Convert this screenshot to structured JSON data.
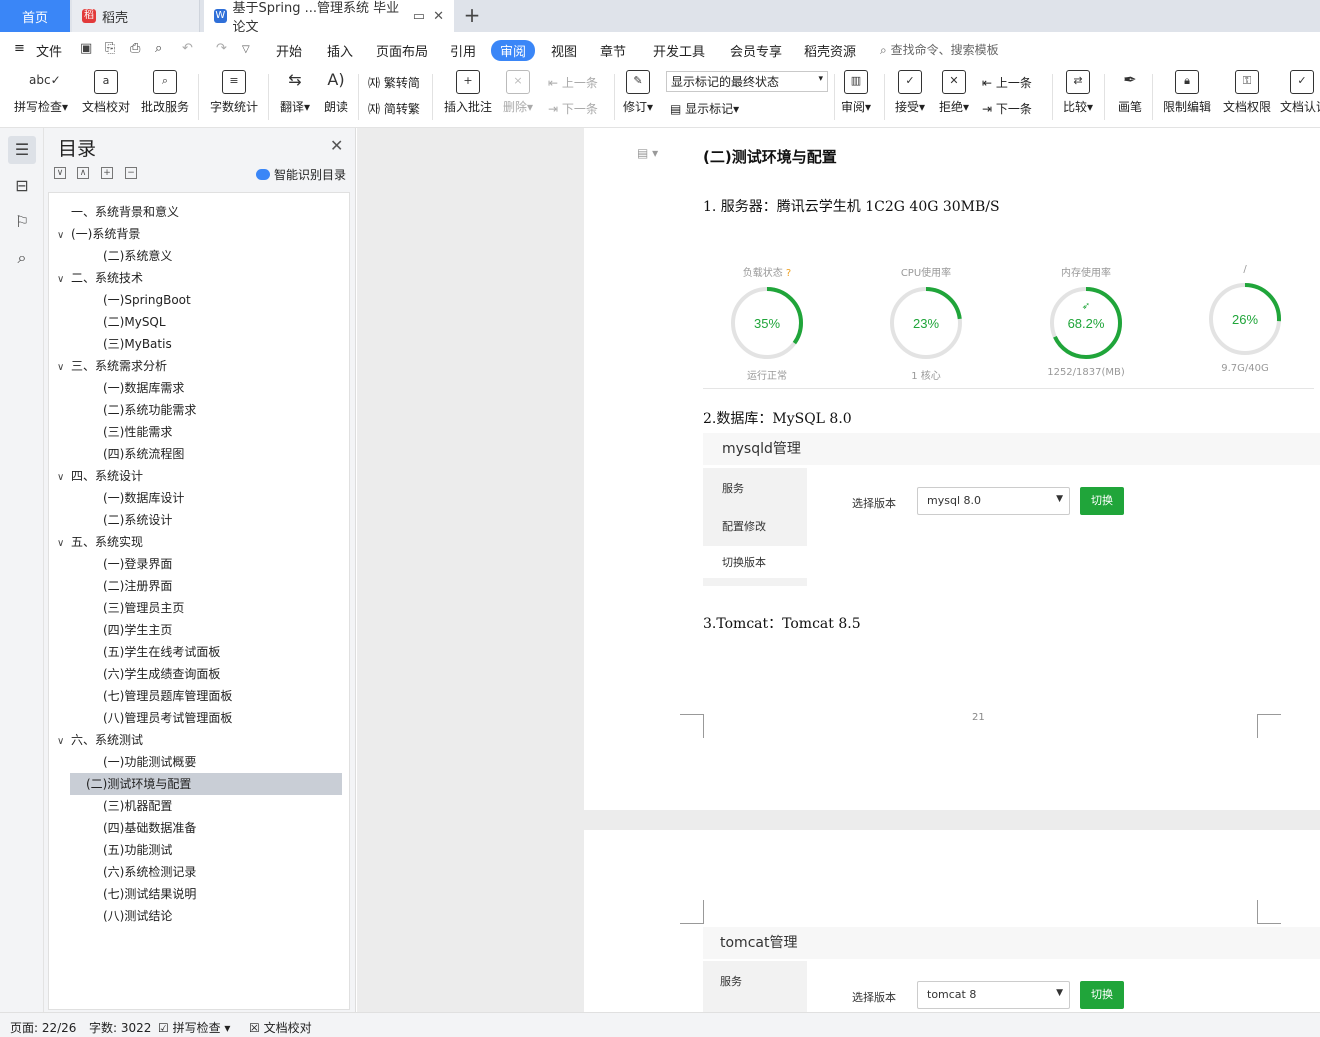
{
  "tabs": {
    "home": "首页",
    "daoke": "稻壳",
    "doc": "基于Spring ...管理系统 毕业论文"
  },
  "menu": [
    "文件",
    "开始",
    "插入",
    "页面布局",
    "引用",
    "审阅",
    "视图",
    "章节",
    "开发工具",
    "会员专享",
    "稻壳资源"
  ],
  "search_placeholder": "查找命令、搜索模板",
  "ribbon": {
    "spell": "拼写检查",
    "proof": "文档校对",
    "batch": "批改服务",
    "wordcount": "字数统计",
    "translate": "翻译",
    "read": "朗读",
    "t2s": "繁转简",
    "s2t": "简转繁",
    "comment": "插入批注",
    "delete": "删除",
    "prev": "上一条",
    "next": "下一条",
    "revise": "修订",
    "markup_state": "显示标记的最终状态",
    "show_markup": "显示标记",
    "review": "审阅",
    "accept": "接受",
    "reject": "拒绝",
    "prev2": "上一条",
    "next2": "下一条",
    "compare": "比较",
    "pen": "画笔",
    "restrict": "限制编辑",
    "perm": "文档权限",
    "cert": "文档认证"
  },
  "toc": {
    "title": "目录",
    "smart": "智能识别目录",
    "items": [
      {
        "text": "一、系统背景和意义",
        "level": 1,
        "arrow": ""
      },
      {
        "text": "(一)系统背景",
        "level": 1,
        "arrow": "∨"
      },
      {
        "text": "(二)系统意义",
        "level": 2,
        "arrow": ""
      },
      {
        "text": "二、系统技术",
        "level": 1,
        "arrow": "∨"
      },
      {
        "text": "(一)SpringBoot",
        "level": 2,
        "arrow": ""
      },
      {
        "text": "(二)MySQL",
        "level": 2,
        "arrow": ""
      },
      {
        "text": "(三)MyBatis",
        "level": 2,
        "arrow": ""
      },
      {
        "text": "三、系统需求分析",
        "level": 1,
        "arrow": "∨"
      },
      {
        "text": "(一)数据库需求",
        "level": 2,
        "arrow": ""
      },
      {
        "text": "(二)系统功能需求",
        "level": 2,
        "arrow": ""
      },
      {
        "text": "(三)性能需求",
        "level": 2,
        "arrow": ""
      },
      {
        "text": "(四)系统流程图",
        "level": 2,
        "arrow": ""
      },
      {
        "text": "四、系统设计",
        "level": 1,
        "arrow": "∨"
      },
      {
        "text": "(一)数据库设计",
        "level": 2,
        "arrow": ""
      },
      {
        "text": "(二)系统设计",
        "level": 2,
        "arrow": ""
      },
      {
        "text": "五、系统实现",
        "level": 1,
        "arrow": "∨"
      },
      {
        "text": "(一)登录界面",
        "level": 2,
        "arrow": ""
      },
      {
        "text": "(二)注册界面",
        "level": 2,
        "arrow": ""
      },
      {
        "text": "(三)管理员主页",
        "level": 2,
        "arrow": ""
      },
      {
        "text": "(四)学生主页",
        "level": 2,
        "arrow": ""
      },
      {
        "text": "(五)学生在线考试面板",
        "level": 2,
        "arrow": ""
      },
      {
        "text": "(六)学生成绩查询面板",
        "level": 2,
        "arrow": ""
      },
      {
        "text": "(七)管理员题库管理面板",
        "level": 2,
        "arrow": ""
      },
      {
        "text": "(八)管理员考试管理面板",
        "level": 2,
        "arrow": ""
      },
      {
        "text": "六、系统测试",
        "level": 1,
        "arrow": "∨"
      },
      {
        "text": "(一)功能测试概要",
        "level": 2,
        "arrow": ""
      },
      {
        "text": "(二)测试环境与配置",
        "level": 2,
        "arrow": "",
        "selected": true
      },
      {
        "text": "(三)机器配置",
        "level": 2,
        "arrow": ""
      },
      {
        "text": "(四)基础数据准备",
        "level": 2,
        "arrow": ""
      },
      {
        "text": "(五)功能测试",
        "level": 2,
        "arrow": ""
      },
      {
        "text": "(六)系统检测记录",
        "level": 2,
        "arrow": ""
      },
      {
        "text": "(七)测试结果说明",
        "level": 2,
        "arrow": ""
      },
      {
        "text": "(八)测试结论",
        "level": 2,
        "arrow": ""
      }
    ]
  },
  "doc": {
    "heading": "(二)测试环境与配置",
    "server": "1. 服务器：腾讯云学生机 1C2G 40G 30MB/S",
    "gauges": [
      {
        "label": "负载状态",
        "value": "35%",
        "sub": "运行正常",
        "pct": 35
      },
      {
        "label": "CPU使用率",
        "value": "23%",
        "sub": "1 核心",
        "pct": 23
      },
      {
        "label": "内存使用率",
        "value": "68.2%",
        "sub": "1252/1837(MB)",
        "pct": 68.2
      },
      {
        "label": "/",
        "value": "26%",
        "sub": "9.7G/40G",
        "pct": 26
      }
    ],
    "db": "2.数据库：MySQL 8.0",
    "mysql_panel": {
      "title": "mysqld管理",
      "side": [
        "服务",
        "配置修改",
        "切换版本"
      ],
      "label": "选择版本",
      "value": "mysql 8.0",
      "button": "切换"
    },
    "tomcat": "3.Tomcat：Tomcat 8.5",
    "page_no": "21",
    "tomcat_panel": {
      "title": "tomcat管理",
      "side": [
        "服务"
      ],
      "label": "选择版本",
      "value": "tomcat 8",
      "button": "切换"
    }
  },
  "status": {
    "page": "页面: 22/26",
    "words": "字数: 3022",
    "spell": "拼写检查",
    "proof": "文档校对"
  },
  "colors": {
    "accent": "#3a86f7",
    "gauge_green": "#20a53a"
  }
}
